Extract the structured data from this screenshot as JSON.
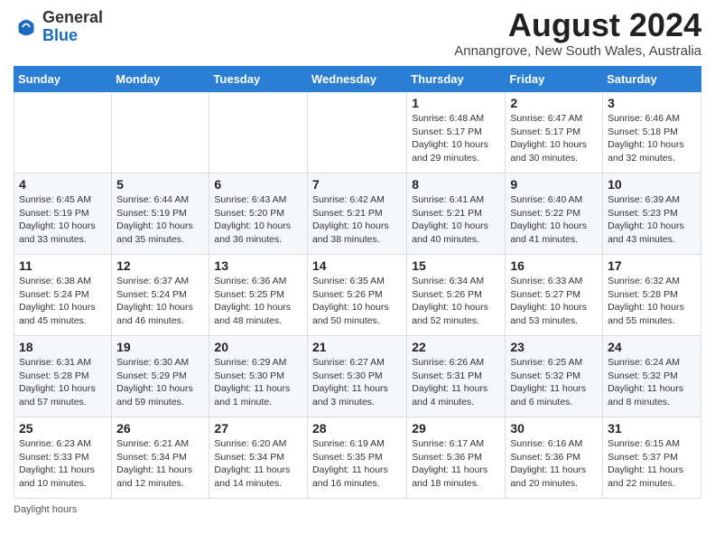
{
  "logo": {
    "general": "General",
    "blue": "Blue"
  },
  "title": {
    "month_year": "August 2024",
    "location": "Annangrove, New South Wales, Australia"
  },
  "calendar": {
    "headers": [
      "Sunday",
      "Monday",
      "Tuesday",
      "Wednesday",
      "Thursday",
      "Friday",
      "Saturday"
    ],
    "weeks": [
      [
        {
          "day": "",
          "info": ""
        },
        {
          "day": "",
          "info": ""
        },
        {
          "day": "",
          "info": ""
        },
        {
          "day": "",
          "info": ""
        },
        {
          "day": "1",
          "info": "Sunrise: 6:48 AM\nSunset: 5:17 PM\nDaylight: 10 hours and 29 minutes."
        },
        {
          "day": "2",
          "info": "Sunrise: 6:47 AM\nSunset: 5:17 PM\nDaylight: 10 hours and 30 minutes."
        },
        {
          "day": "3",
          "info": "Sunrise: 6:46 AM\nSunset: 5:18 PM\nDaylight: 10 hours and 32 minutes."
        }
      ],
      [
        {
          "day": "4",
          "info": "Sunrise: 6:45 AM\nSunset: 5:19 PM\nDaylight: 10 hours and 33 minutes."
        },
        {
          "day": "5",
          "info": "Sunrise: 6:44 AM\nSunset: 5:19 PM\nDaylight: 10 hours and 35 minutes."
        },
        {
          "day": "6",
          "info": "Sunrise: 6:43 AM\nSunset: 5:20 PM\nDaylight: 10 hours and 36 minutes."
        },
        {
          "day": "7",
          "info": "Sunrise: 6:42 AM\nSunset: 5:21 PM\nDaylight: 10 hours and 38 minutes."
        },
        {
          "day": "8",
          "info": "Sunrise: 6:41 AM\nSunset: 5:21 PM\nDaylight: 10 hours and 40 minutes."
        },
        {
          "day": "9",
          "info": "Sunrise: 6:40 AM\nSunset: 5:22 PM\nDaylight: 10 hours and 41 minutes."
        },
        {
          "day": "10",
          "info": "Sunrise: 6:39 AM\nSunset: 5:23 PM\nDaylight: 10 hours and 43 minutes."
        }
      ],
      [
        {
          "day": "11",
          "info": "Sunrise: 6:38 AM\nSunset: 5:24 PM\nDaylight: 10 hours and 45 minutes."
        },
        {
          "day": "12",
          "info": "Sunrise: 6:37 AM\nSunset: 5:24 PM\nDaylight: 10 hours and 46 minutes."
        },
        {
          "day": "13",
          "info": "Sunrise: 6:36 AM\nSunset: 5:25 PM\nDaylight: 10 hours and 48 minutes."
        },
        {
          "day": "14",
          "info": "Sunrise: 6:35 AM\nSunset: 5:26 PM\nDaylight: 10 hours and 50 minutes."
        },
        {
          "day": "15",
          "info": "Sunrise: 6:34 AM\nSunset: 5:26 PM\nDaylight: 10 hours and 52 minutes."
        },
        {
          "day": "16",
          "info": "Sunrise: 6:33 AM\nSunset: 5:27 PM\nDaylight: 10 hours and 53 minutes."
        },
        {
          "day": "17",
          "info": "Sunrise: 6:32 AM\nSunset: 5:28 PM\nDaylight: 10 hours and 55 minutes."
        }
      ],
      [
        {
          "day": "18",
          "info": "Sunrise: 6:31 AM\nSunset: 5:28 PM\nDaylight: 10 hours and 57 minutes."
        },
        {
          "day": "19",
          "info": "Sunrise: 6:30 AM\nSunset: 5:29 PM\nDaylight: 10 hours and 59 minutes."
        },
        {
          "day": "20",
          "info": "Sunrise: 6:29 AM\nSunset: 5:30 PM\nDaylight: 11 hours and 1 minute."
        },
        {
          "day": "21",
          "info": "Sunrise: 6:27 AM\nSunset: 5:30 PM\nDaylight: 11 hours and 3 minutes."
        },
        {
          "day": "22",
          "info": "Sunrise: 6:26 AM\nSunset: 5:31 PM\nDaylight: 11 hours and 4 minutes."
        },
        {
          "day": "23",
          "info": "Sunrise: 6:25 AM\nSunset: 5:32 PM\nDaylight: 11 hours and 6 minutes."
        },
        {
          "day": "24",
          "info": "Sunrise: 6:24 AM\nSunset: 5:32 PM\nDaylight: 11 hours and 8 minutes."
        }
      ],
      [
        {
          "day": "25",
          "info": "Sunrise: 6:23 AM\nSunset: 5:33 PM\nDaylight: 11 hours and 10 minutes."
        },
        {
          "day": "26",
          "info": "Sunrise: 6:21 AM\nSunset: 5:34 PM\nDaylight: 11 hours and 12 minutes."
        },
        {
          "day": "27",
          "info": "Sunrise: 6:20 AM\nSunset: 5:34 PM\nDaylight: 11 hours and 14 minutes."
        },
        {
          "day": "28",
          "info": "Sunrise: 6:19 AM\nSunset: 5:35 PM\nDaylight: 11 hours and 16 minutes."
        },
        {
          "day": "29",
          "info": "Sunrise: 6:17 AM\nSunset: 5:36 PM\nDaylight: 11 hours and 18 minutes."
        },
        {
          "day": "30",
          "info": "Sunrise: 6:16 AM\nSunset: 5:36 PM\nDaylight: 11 hours and 20 minutes."
        },
        {
          "day": "31",
          "info": "Sunrise: 6:15 AM\nSunset: 5:37 PM\nDaylight: 11 hours and 22 minutes."
        }
      ]
    ]
  },
  "footer": {
    "note": "Daylight hours"
  }
}
